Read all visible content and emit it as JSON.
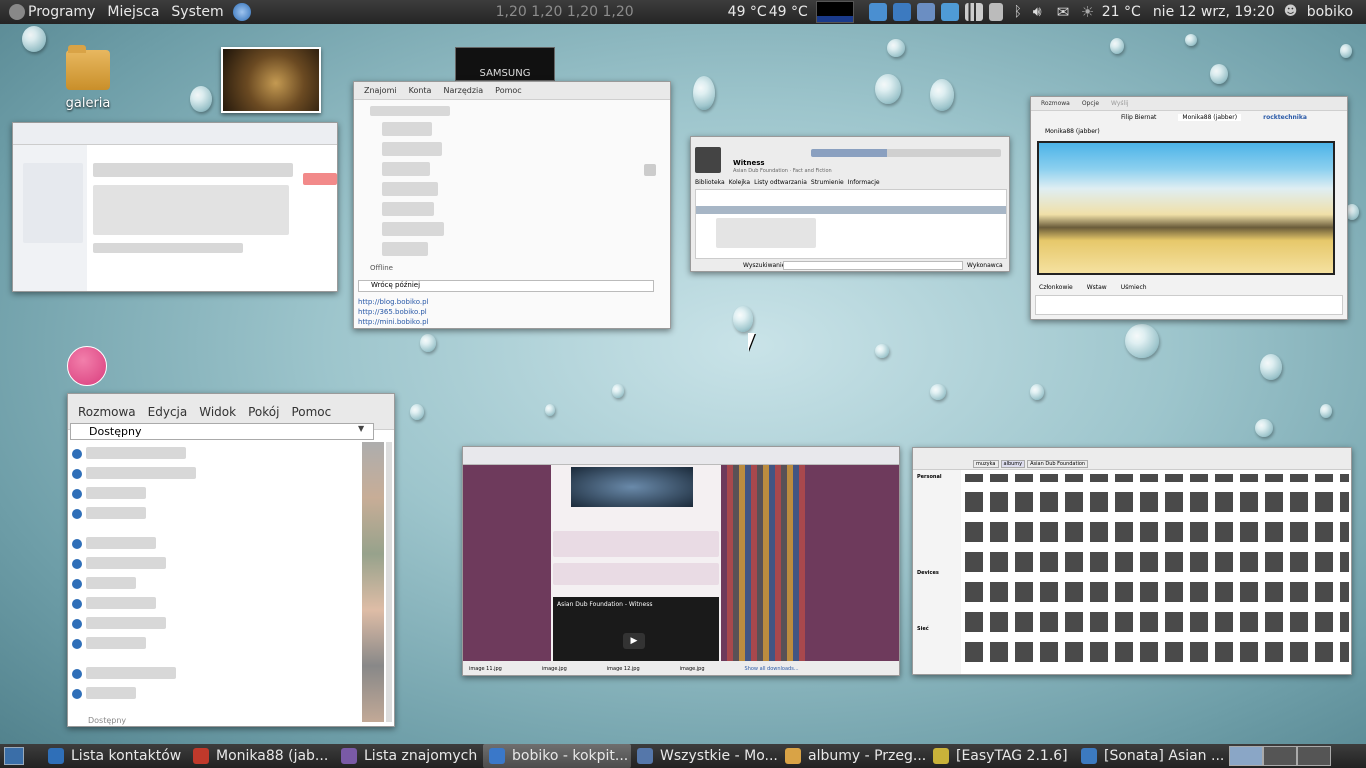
{
  "top_panel": {
    "menu_programs": "Programy",
    "menu_places": "Miejsca",
    "menu_system": "System",
    "load_readout": "1,20 1,20  1,20 1,20",
    "temp_1": "49 °C",
    "temp_2": "49 °C",
    "weather_temp": "21 °C",
    "datetime": "nie 12 wrz, 19:20",
    "username": "bobiko"
  },
  "desktop": {
    "folder_label": "galeria",
    "samsung_label": "SAMSUNG"
  },
  "windows": {
    "contacts": {
      "menu": [
        "Rozmowa",
        "Edycja",
        "Widok",
        "Pokój",
        "Pomoc"
      ],
      "status": "Dostępny",
      "footer": "Dostępny"
    },
    "friends": {
      "menu": [
        "Znajomi",
        "Konta",
        "Narzędzia",
        "Pomoc"
      ],
      "status": "Wrócę później",
      "offline": "Offline",
      "links": [
        "http://blog.bobiko.pl",
        "http://365.bobiko.pl",
        "http://mini.bobiko.pl"
      ]
    },
    "sonata": {
      "track": "Witness",
      "artist": "Asian Dub Foundation · Fact and Fiction",
      "tabs": [
        "Biblioteka",
        "Kolejka",
        "Listy odtwarzania",
        "Strumienie",
        "Informacje"
      ],
      "search_label": "Wyszukiwanie:",
      "filter_label": "Wykonawca"
    },
    "chat": {
      "menu": [
        "Rozmowa",
        "Opcje",
        "Wyślij"
      ],
      "tabs": [
        "rocktechnika",
        "Monika88 (jabber)",
        "Filip Biernat"
      ],
      "contact": "Monika88 (jabber)",
      "bottom": [
        "Członkowie",
        "Wstaw",
        "Uśmiech"
      ]
    },
    "browser": {
      "video_title": "Asian Dub Foundation - Witness",
      "downloads": [
        "image 11.jpg",
        "image.jpg",
        "image 12.jpg",
        "image.jpg"
      ],
      "show_all": "Show all downloads..."
    },
    "files": {
      "path": [
        "muzyka",
        "albumy",
        "Asian Dub Foundation"
      ],
      "sidebar": [
        "Personal",
        "Devices",
        "Sieć"
      ]
    }
  },
  "bottom_panel": {
    "tasks": [
      {
        "label": "Lista kontaktów",
        "color": "#2f6fb8"
      },
      {
        "label": "Monika88 (jab...",
        "color": "#c0392b"
      },
      {
        "label": "Lista znajomych",
        "color": "#7a5aa6"
      },
      {
        "label": "bobiko - kokpit...",
        "color": "#3a78c9"
      },
      {
        "label": "Wszystkie - Mo...",
        "color": "#5577aa"
      },
      {
        "label": "albumy - Przeg...",
        "color": "#d9a346"
      },
      {
        "label": "[EasyTAG 2.1.6]",
        "color": "#c9b23a"
      },
      {
        "label": "[Sonata] Asian ...",
        "color": "#3c7ac0"
      }
    ]
  }
}
